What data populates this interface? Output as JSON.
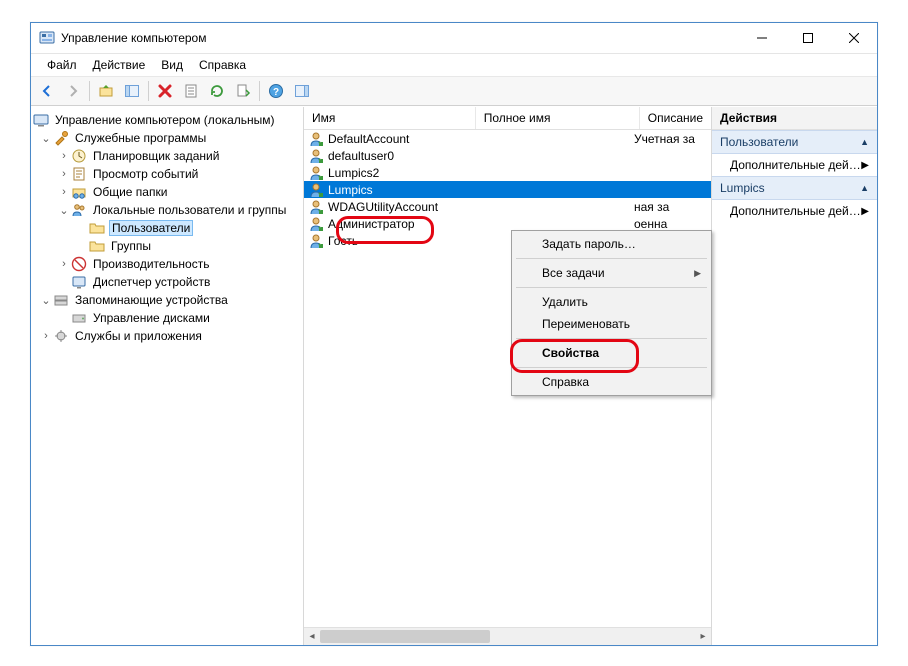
{
  "window": {
    "title": "Управление компьютером"
  },
  "menu": {
    "file": "Файл",
    "action": "Действие",
    "view": "Вид",
    "help": "Справка"
  },
  "tree": {
    "root": "Управление компьютером (локальным)",
    "n1": "Служебные программы",
    "n1_1": "Планировщик заданий",
    "n1_2": "Просмотр событий",
    "n1_3": "Общие папки",
    "n1_4": "Локальные пользователи и группы",
    "n1_4_1": "Пользователи",
    "n1_4_2": "Группы",
    "n1_5": "Производительность",
    "n1_6": "Диспетчер устройств",
    "n2": "Запоминающие устройства",
    "n2_1": "Управление дисками",
    "n3": "Службы и приложения"
  },
  "list": {
    "col_name": "Имя",
    "col_full": "Полное имя",
    "col_desc": "Описание",
    "rows": [
      {
        "name": "DefaultAccount",
        "full": "",
        "desc": "Учетная за"
      },
      {
        "name": "defaultuser0",
        "full": "",
        "desc": ""
      },
      {
        "name": "Lumpics2",
        "full": "",
        "desc": ""
      },
      {
        "name": "Lumpics",
        "full": "",
        "desc": ""
      },
      {
        "name": "WDAGUtilityAccount",
        "full": "",
        "desc": "ная за"
      },
      {
        "name": "Администратор",
        "full": "",
        "desc": "оенна"
      },
      {
        "name": "Гость",
        "full": "",
        "desc": "оенна"
      }
    ]
  },
  "actions": {
    "title": "Действия",
    "group1": "Пользователи",
    "link_more": "Дополнительные дей…",
    "group2": "Lumpics"
  },
  "ctx": {
    "set_pwd": "Задать пароль…",
    "all_tasks": "Все задачи",
    "delete": "Удалить",
    "rename": "Переименовать",
    "properties": "Свойства",
    "help": "Справка"
  }
}
